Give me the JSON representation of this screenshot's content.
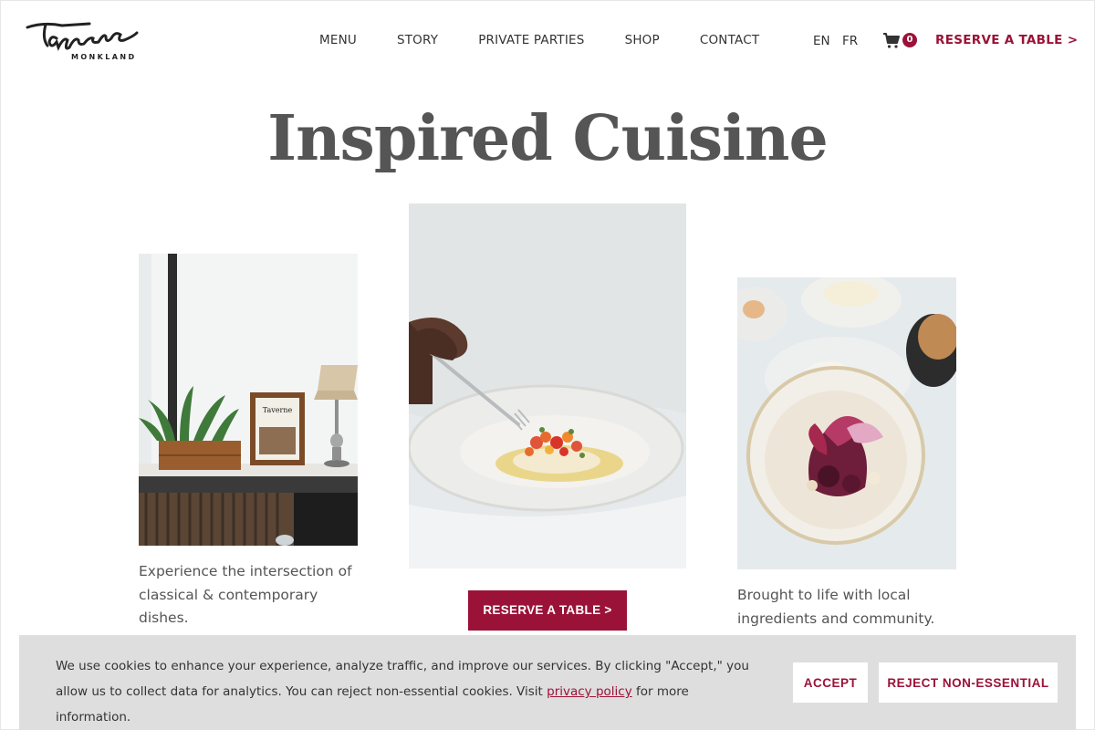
{
  "header": {
    "logo_text": "Taverne",
    "logo_subtext": "MONKLAND",
    "nav": [
      "MENU",
      "STORY",
      "PRIVATE PARTIES",
      "SHOP",
      "CONTACT"
    ],
    "lang_en": "EN",
    "lang_fr": "FR",
    "cart_count": "0",
    "reserve_label": "RESERVE A TABLE >"
  },
  "hero": {
    "title": "Inspired Cuisine",
    "caption_left": "Experience the intersection of classical & contemporary dishes.",
    "caption_right": "Brought to life with local ingredients and community.",
    "reserve_label": "RESERVE A TABLE >"
  },
  "cookie_banner": {
    "text_before": "We use cookies to enhance your experience, analyze traffic, and improve our services. By clicking \"Accept,\" you allow us to collect data for analytics. You can reject non-essential cookies. Visit ",
    "link_text": "privacy policy",
    "text_after": " for more information.",
    "accept_label": "ACCEPT",
    "reject_label": "REJECT NON-ESSENTIAL"
  },
  "colors": {
    "brand": "#9b1238",
    "title": "#555555",
    "banner_bg": "#dedede"
  }
}
